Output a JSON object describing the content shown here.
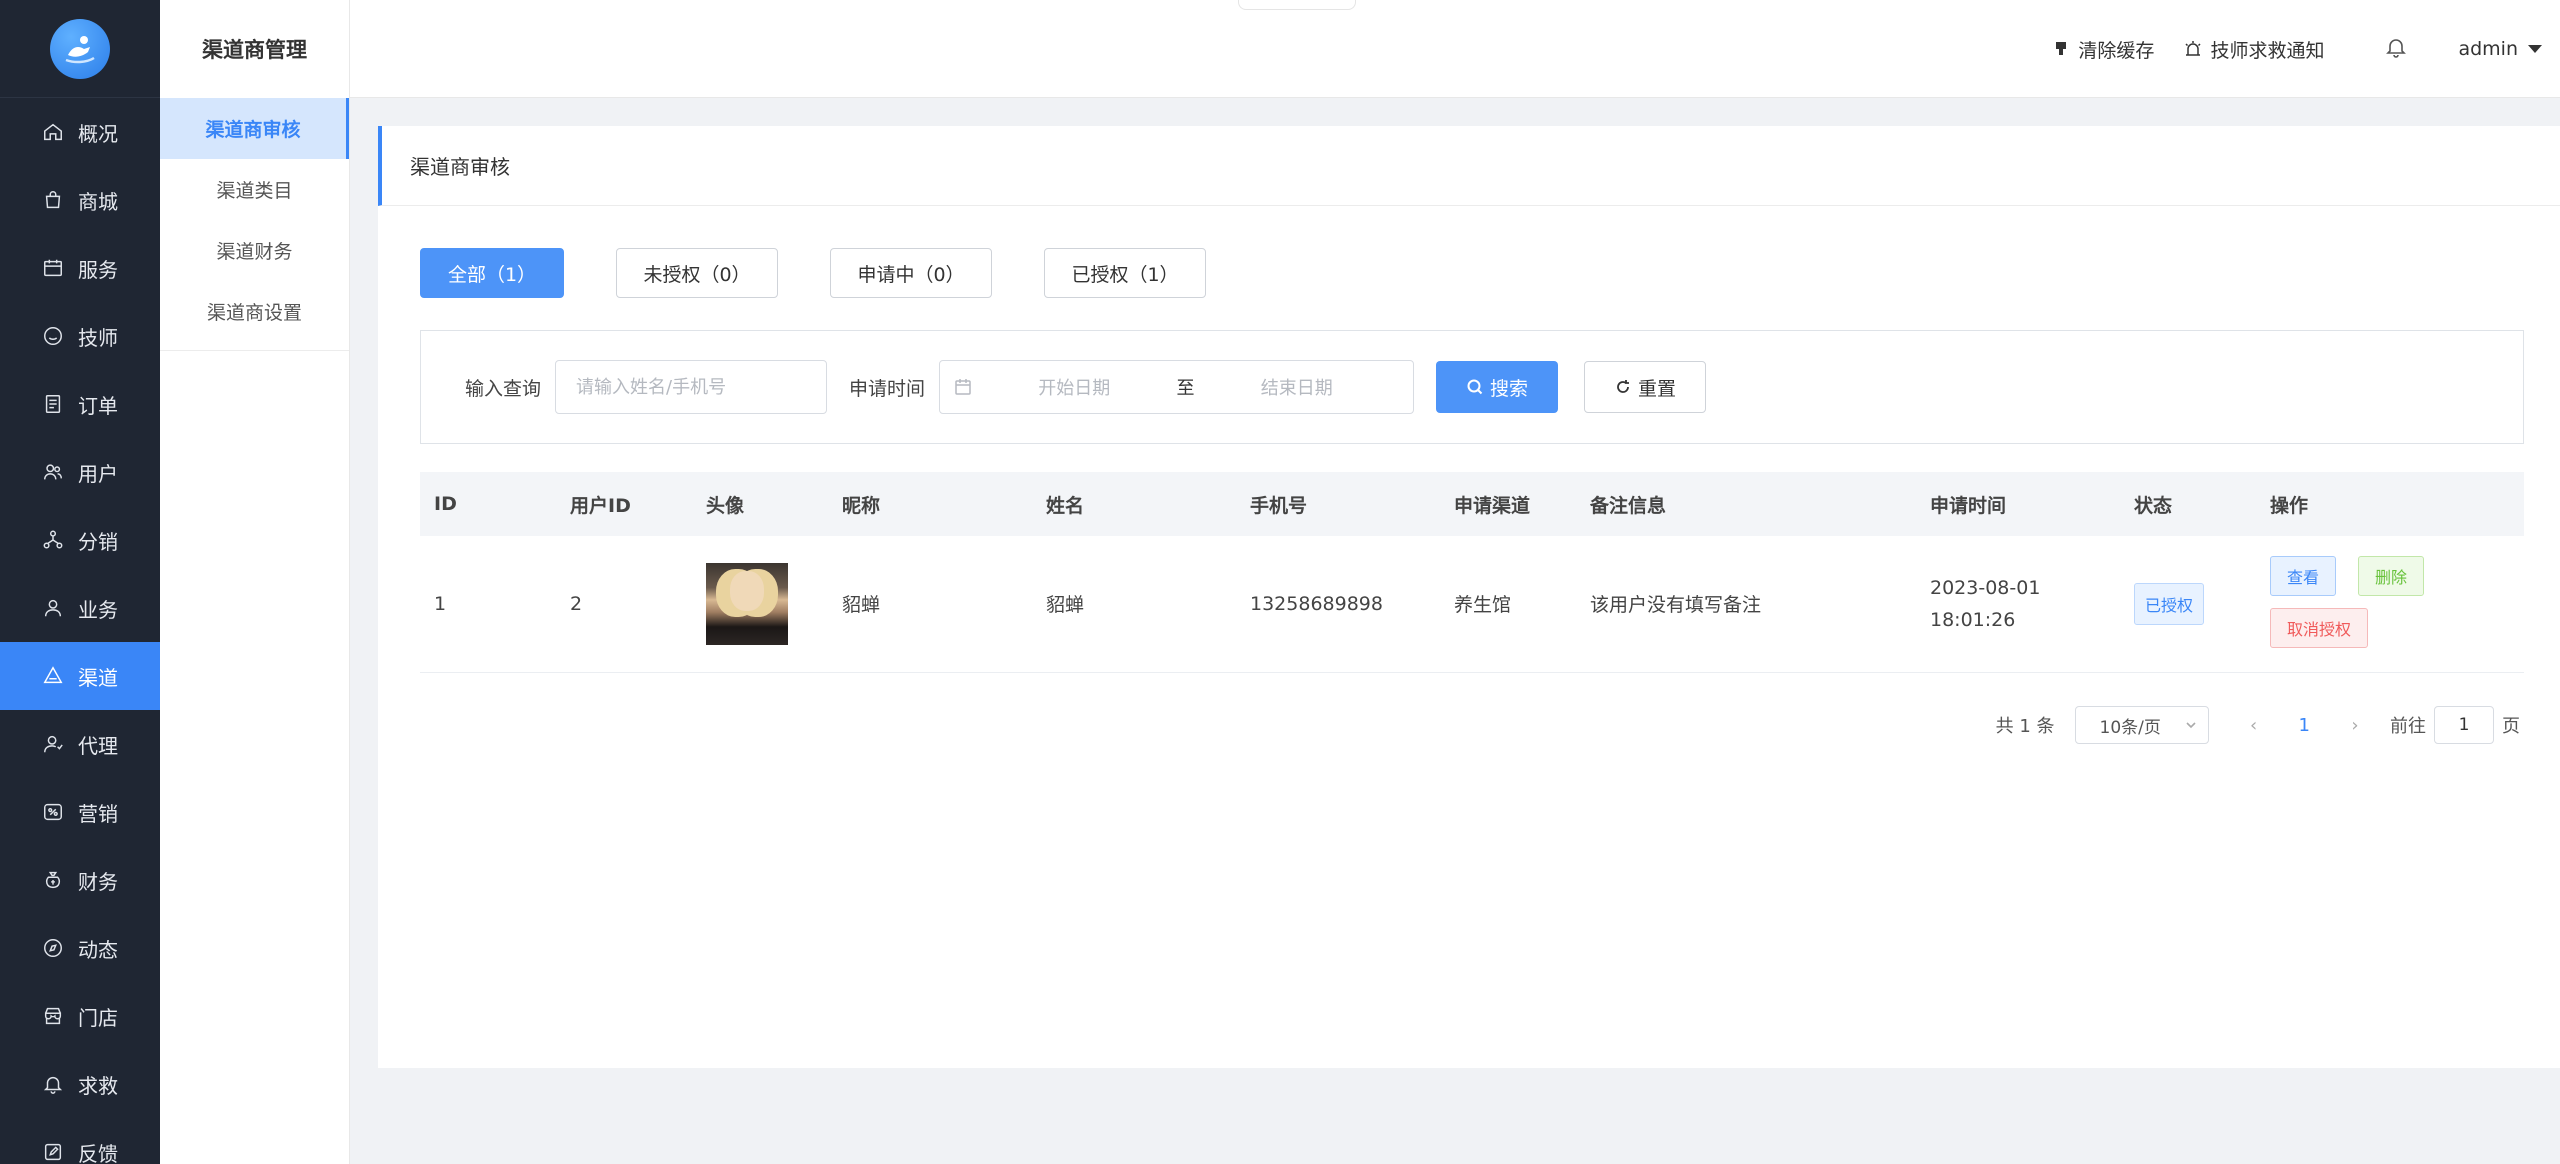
{
  "sidebar": {
    "items": [
      {
        "label": "概况",
        "icon": "home-icon"
      },
      {
        "label": "商城",
        "icon": "shopping-bag-icon"
      },
      {
        "label": "服务",
        "icon": "calendar-icon"
      },
      {
        "label": "技师",
        "icon": "technician-icon"
      },
      {
        "label": "订单",
        "icon": "order-icon"
      },
      {
        "label": "用户",
        "icon": "users-icon"
      },
      {
        "label": "分销",
        "icon": "distribution-icon"
      },
      {
        "label": "业务",
        "icon": "user-icon"
      },
      {
        "label": "渠道",
        "icon": "channel-icon"
      },
      {
        "label": "代理",
        "icon": "agent-icon"
      },
      {
        "label": "营销",
        "icon": "marketing-icon"
      },
      {
        "label": "财务",
        "icon": "money-bag-icon"
      },
      {
        "label": "动态",
        "icon": "compass-icon"
      },
      {
        "label": "门店",
        "icon": "store-icon"
      },
      {
        "label": "求救",
        "icon": "bell-icon"
      },
      {
        "label": "反馈",
        "icon": "feedback-icon"
      }
    ],
    "active_index": 8
  },
  "subnav": {
    "title": "渠道商管理",
    "items": [
      "渠道商审核",
      "渠道类目",
      "渠道财务",
      "渠道商设置"
    ]
  },
  "header": {
    "clear_cache": "清除缓存",
    "tech_sos": "技师求救通知",
    "user": "admin"
  },
  "page": {
    "title": "渠道商审核",
    "tabs": [
      "全部（1）",
      "未授权（0）",
      "申请中（0）",
      "已授权（1）"
    ]
  },
  "filter": {
    "query_label": "输入查询",
    "query_placeholder": "请输入姓名/手机号",
    "time_label": "申请时间",
    "start_placeholder": "开始日期",
    "separator": "至",
    "end_placeholder": "结束日期",
    "search_label": "搜索",
    "reset_label": "重置"
  },
  "table": {
    "columns": [
      "ID",
      "用户ID",
      "头像",
      "昵称",
      "姓名",
      "手机号",
      "申请渠道",
      "备注信息",
      "申请时间",
      "状态",
      "操作"
    ],
    "rows": [
      {
        "id": "1",
        "user_id": "2",
        "nickname": "貂蝉",
        "name": "貂蝉",
        "phone": "13258689898",
        "channel": "养生馆",
        "remark": "该用户没有填写备注",
        "date": "2023-08-01",
        "time": "18:01:26",
        "status": "已授权",
        "actions": {
          "view": "查看",
          "delete": "删除",
          "revoke": "取消授权"
        }
      }
    ]
  },
  "pager": {
    "total": "共 1 条",
    "page_size": "10条/页",
    "prev": "‹",
    "current": "1",
    "next": "›",
    "goto_label": "前往",
    "goto_value": "1",
    "page_suffix": "页"
  },
  "colors": {
    "primary": "#3a86f7",
    "sidebar_bg": "#1f2633"
  }
}
